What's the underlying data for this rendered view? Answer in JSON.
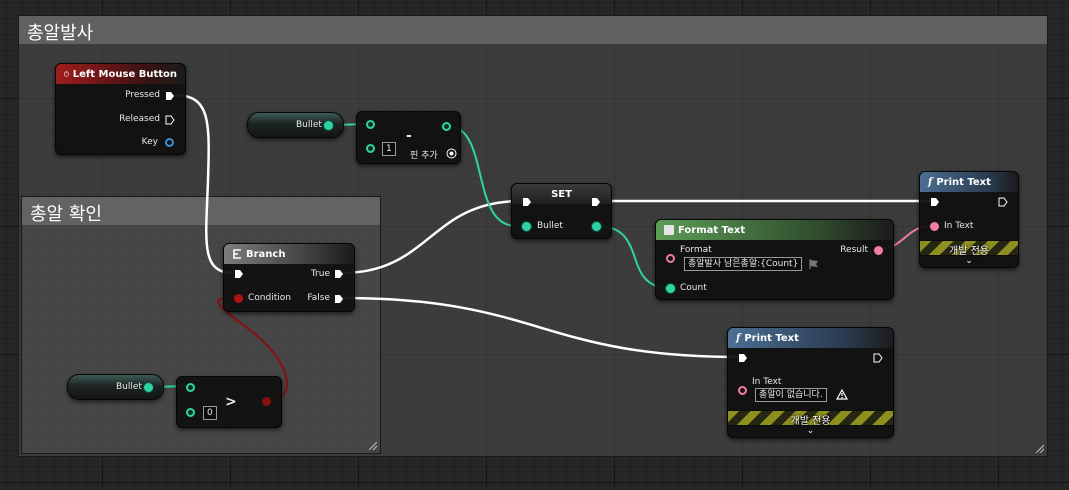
{
  "comments": {
    "fire": {
      "title": "총알발사"
    },
    "check": {
      "title": "총알 확인"
    }
  },
  "nodes": {
    "left_mouse": {
      "title": "Left Mouse Button",
      "pins": {
        "pressed": "Pressed",
        "released": "Released",
        "key": "Key"
      }
    },
    "bullet_get_top": {
      "label": "Bullet"
    },
    "subtract": {
      "operator": "-",
      "input_value": "1",
      "add_pin": "핀 추가"
    },
    "set": {
      "title": "SET",
      "pin": "Bullet"
    },
    "format_text": {
      "title": "Format Text",
      "format_label": "Format",
      "format_value": "총알발사 남은총알:{Count}",
      "result": "Result",
      "count": "Count"
    },
    "print_text_top": {
      "title": "Print Text",
      "in_text": "In Text",
      "dev_only": "개발 전용"
    },
    "branch": {
      "title": "Branch",
      "condition": "Condition",
      "true": "True",
      "false": "False"
    },
    "print_text_bottom": {
      "title": "Print Text",
      "in_text": "In Text",
      "in_text_value": "총알이 없습니다.",
      "dev_only": "개발 전용"
    },
    "bullet_get_bottom": {
      "label": "Bullet"
    },
    "greater": {
      "operator": ">",
      "input_value": "0"
    }
  },
  "icons": {
    "mouse": "mouse-icon",
    "branch": "branch-icon",
    "function": "function-icon",
    "warning": "warning-icon",
    "flag": "flag-icon",
    "add_pin": "add-pin-icon",
    "chevron": "chevron-down-icon"
  },
  "colors": {
    "exec_wire": "#ffffff",
    "int_wire": "#2fd3a3",
    "text_wire": "#f27ba7",
    "bool_wire": "#9a1010",
    "event_header": "#a01c1c",
    "function_header": "#4c6f94",
    "format_header": "#5d9d57"
  }
}
